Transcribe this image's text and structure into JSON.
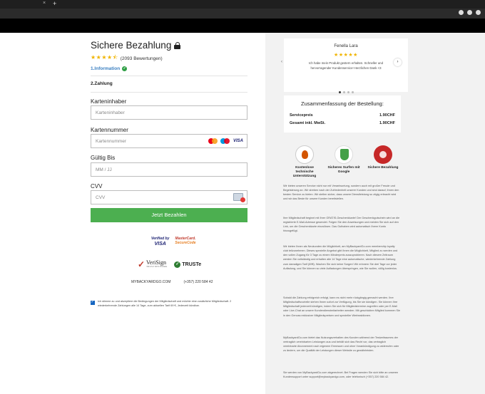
{
  "browser": {
    "new_tab_glyph": "+",
    "close_glyph": "×"
  },
  "checkout": {
    "title": "Sichere Bezahlung",
    "rating": {
      "stars": 4.5,
      "count_text": "(2093 Bewertungen)"
    },
    "step1_label": "1.Information",
    "step2_label": "2.Zahlung",
    "fields": {
      "holder": {
        "label": "Karteninhaber",
        "placeholder": "Karteninhaber"
      },
      "number": {
        "label": "Kartennummer",
        "placeholder": "Kartennummer"
      },
      "expiry": {
        "label": "Gültig Bis",
        "placeholder": "MM / JJ"
      },
      "cvv": {
        "label": "CVV",
        "placeholder": "CVV"
      }
    },
    "card_brands": [
      "mastercard",
      "maestro",
      "VISA"
    ],
    "pay_button": "Jetzt Bezahlen",
    "badges": {
      "vbv_line1": "Verified by",
      "vbv_line2": "VISA",
      "msc_line1": "MasterCard.",
      "msc_line2": "SecureCode",
      "verisign": "VeriSign",
      "verisign_sub": "TRUST NETWORK",
      "truste": "TRUSTe"
    },
    "contact": {
      "site": "MYBACKYARDGO.COM",
      "phone": "(+357) 220 584 42"
    },
    "consent_text": "Ich stimme zu und akzeptiere die Bedingungen der Mitgliedschaft und möchte eine zusätzliche Mitgliedschaft. 2 wiederkehrende Zahlungen alle 14 Tage, zum aktuellen Tarif 69 €, Jederzeit kündbar."
  },
  "testimonial": {
    "name": "Fenella Lara",
    "stars": 5,
    "text": "Ich habe mein Produkt gestern erhalten. Schneller und hervorragender Kundenservice! Herzlichen Dank <3",
    "slide_count": 4,
    "active_slide": 1,
    "prev_glyph": "‹",
    "next_glyph": "›"
  },
  "summary": {
    "title": "Zusammenfassung der Bestellung:",
    "rows": [
      {
        "label": "Servicepreis",
        "value": "1.90CHF"
      },
      {
        "label": "Gesamt inkl. MwSt.",
        "value": "1.90CHF"
      }
    ]
  },
  "features": [
    {
      "icon": "support-agent-icon",
      "label": "Kostenlose technische Unterstützung"
    },
    {
      "icon": "google-shield-icon",
      "label": "Sicheres Surfen mit Google"
    },
    {
      "icon": "secure-payment-icon",
      "label": "Sichere Bezahlung"
    }
  ],
  "fine_print": [
    "Wir bieten unseren Service nicht nur mit Verantwortung, sondern auch mit großer Freude und Begeisterung an. Wir streben nach der Zufriedenheit unserer Kunden und sind darauf, ihnen den besten Service zu bieten. Wir stellen sicher, dass unsere Dienstleistung so zügig erbracht wird und wir das Beste für unsere Kunden bereitstellen.",
    "Ihre Mitgliedschaft beginnt mit Ihrer GRATIS-Geschenkkarte! Der Geschenkgutschein wird an die registrierte E-Mail-Adresse gesendet. Folgen Sie den Anweisungen und melden Sie sich auf den Link, um die Geschenkkarte einzulösen. Das Guthaben wird automatisch Ihrem Konto hinzugefügt.",
    "Wir bieten Ihnen als Neukunden die Möglichkeit, am MyBackyardGo.com membership loyalty club teilzunehmen. Dieses spezielle Angebot gibt Ihnen die Möglichkeit, Mitglied zu werden und den vollen Zugang für 3 Tage zu einem Minderpreis auszuprobieren. Nach diesem Zeitraum werden Sie vollständig und erhalten alle 14 Tage eine automatische, wiederkehrende Zahlung zum damaligen Tarif (69€). Wachen Sie sich keine Sorgen! Wir erinnern Sie drei Tage vor jeder Aufladung, und Sie können so viele Aufladungen überspringen, wie Sie wollen, völlig kostenlos.",
    "Sobald die Zahlung erfolgreich erfolgt, kann es nicht mehr rückgängig gemacht werden. Ihre Mitgliedschaftsvorteile stehen Ihnen sofort zur Verfügung, bis Sie sie kündigen. Sie können Ihre Mitgliedschaft jederzeit kündigen, indem Sie sich für Mitgliedstermine zugreifen oder per E-Mail oder Live-Chat an unsere Kundendienstmitarbeiter wenden. Mit geschickten Mitglied kommen Sie in den Genuss exklusiver Mitgliedspreisen und spezieller Werbeaktionen.",
    "MyBackyardGo.com bietet das Nutzungsverhalten des Kunden während der Testzeitraumes der vertraglich vereinbarten Leistungen aus und behält sich das Recht vor, das vertraglich vereinbarte Abonnement nach eigenem Ermessen und ohne Vorankündigung zu widerrufen oder zu ändern, um die Qualität der Leistungen dieser Website zu gewährleisten.",
    "Sie werden von MyBackyardGo.com abgerechnet. Bei Fragen wenden Sie sich bitte an unseren Kundensupport unter support@mybackyardgo.com, oder telefonisch (+357) 220 584 42."
  ]
}
